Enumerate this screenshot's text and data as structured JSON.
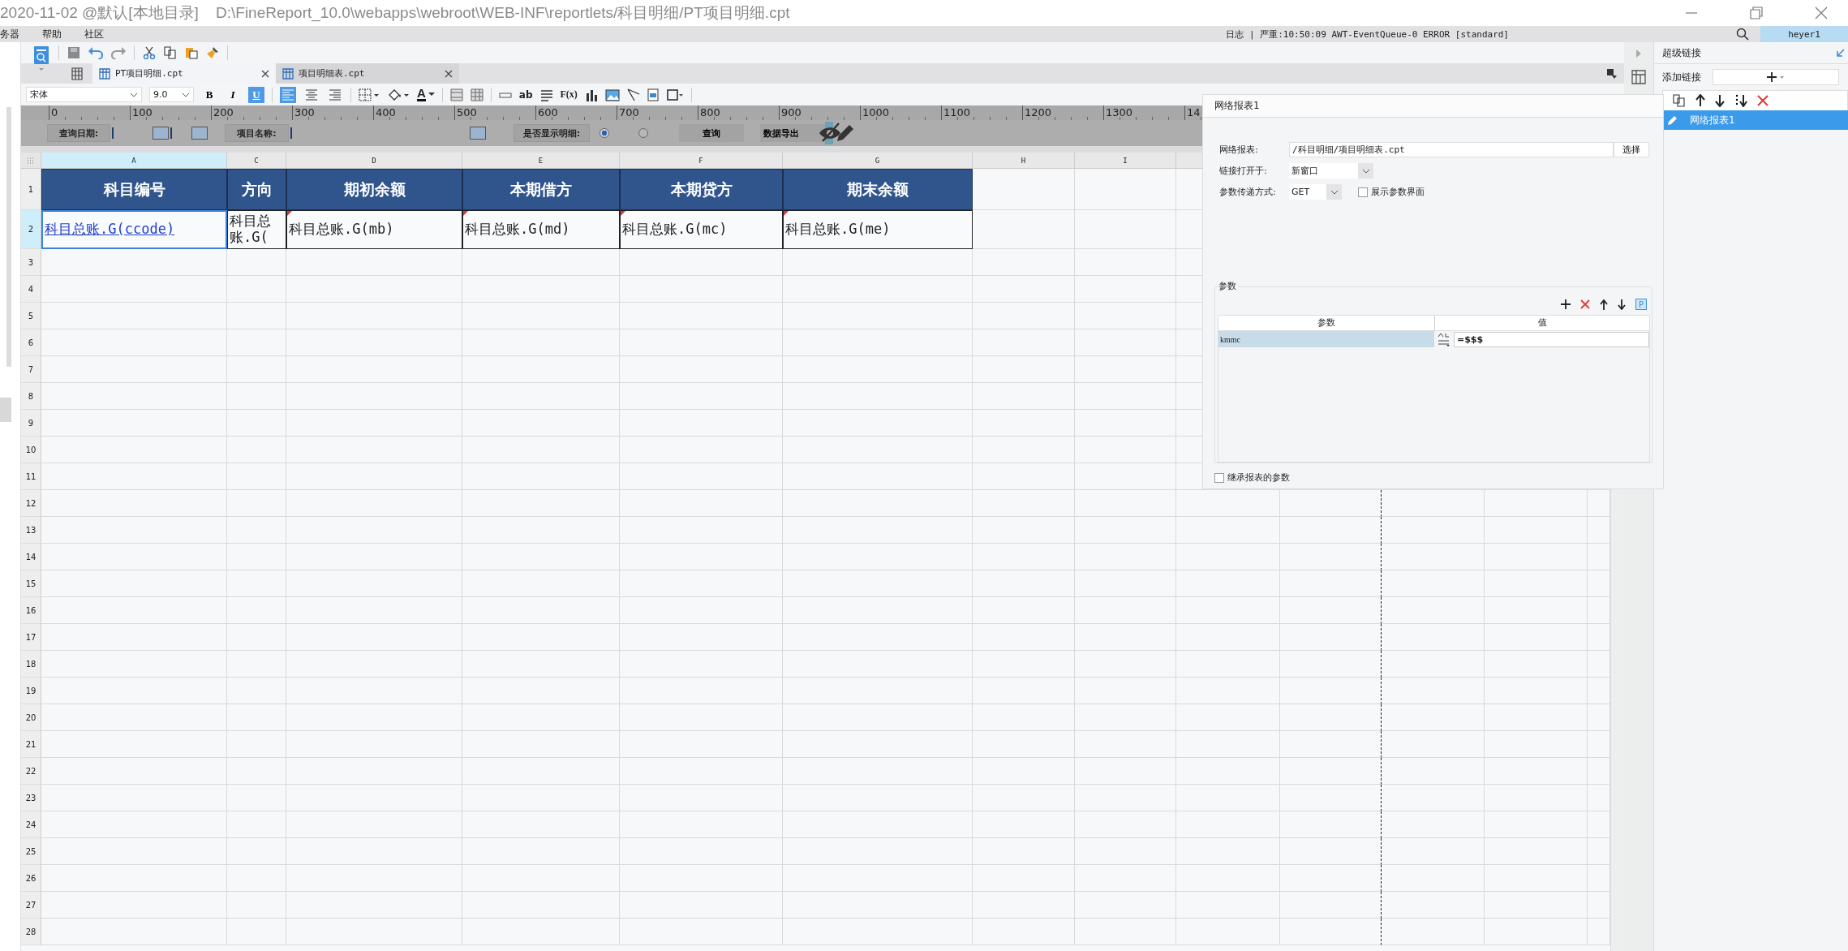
{
  "window": {
    "title": "2020-11-02 @默认[本地目录]    D:\\FineReport_10.0\\webapps\\webroot\\WEB-INF\\reportlets/科目明细/PT项目明细.cpt"
  },
  "menu": [
    {
      "label": "务器"
    },
    {
      "label": "帮助"
    },
    {
      "label": "社区"
    }
  ],
  "log": "日志 | 严重:10:50:09 AWT-EventQueue-0 ERROR [standard]",
  "user": "heyer1",
  "tabs": [
    {
      "label": "PT项目明细.cpt",
      "selected": true
    },
    {
      "label": "项目明细表.cpt",
      "selected": false
    }
  ],
  "format": {
    "font": "宋体",
    "size": "9.0",
    "style_buttons": [
      {
        "label": "B",
        "selected": false
      },
      {
        "label": "I",
        "selected": false
      },
      {
        "label": "U",
        "selected": true
      }
    ],
    "align": [
      {
        "selected": true
      },
      {
        "selected": false
      },
      {
        "selected": false
      }
    ],
    "font_color": "A",
    "text_buttons": [
      "ab",
      "F(x)"
    ]
  },
  "ruler": [
    "0",
    "100",
    "200",
    "300",
    "400",
    "500",
    "600",
    "700",
    "800",
    "900",
    "1000",
    "1100",
    "1200",
    "1300",
    "14"
  ],
  "parameter_form": {
    "date_label": "查询日期:",
    "name_label": "项目名称:",
    "detail_label": "是否显示明细:",
    "detail_options": [
      {
        "selected": true
      },
      {
        "selected": false
      }
    ],
    "buttons": [
      "查询",
      "数据导出"
    ]
  },
  "sheet": {
    "columns": [
      {
        "label": "A",
        "selected": true
      },
      {
        "label": "C",
        "selected": false
      },
      {
        "label": "D",
        "selected": false
      },
      {
        "label": "E",
        "selected": false
      },
      {
        "label": "F",
        "selected": false
      },
      {
        "label": "G",
        "selected": false
      },
      {
        "label": "H",
        "selected": false
      },
      {
        "label": "I",
        "selected": false
      }
    ],
    "rows": [
      {
        "number": "1",
        "selected": false,
        "cells": [
          {
            "kind": "header",
            "text": "科目编号"
          },
          {
            "kind": "header",
            "text": "方向"
          },
          {
            "kind": "header",
            "text": "期初余额"
          },
          {
            "kind": "header",
            "text": "本期借方"
          },
          {
            "kind": "header",
            "text": "本期贷方"
          },
          {
            "kind": "header",
            "text": "期末余额"
          }
        ]
      },
      {
        "number": "2",
        "selected": true,
        "cells": [
          {
            "kind": "link",
            "text": "科目总账.G(ccode)",
            "selected": true,
            "flag": false
          },
          {
            "kind": "text",
            "text": "科目总账.G(",
            "selected": false,
            "flag": false
          },
          {
            "kind": "text",
            "text": "科目总账.G(mb)",
            "selected": false,
            "flag": true
          },
          {
            "kind": "text",
            "text": "科目总账.G(md)",
            "selected": false,
            "flag": true
          },
          {
            "kind": "text",
            "text": "科目总账.G(mc)",
            "selected": false,
            "flag": true
          },
          {
            "kind": "text",
            "text": "科目总账.G(me)",
            "selected": false,
            "flag": true
          }
        ]
      },
      {
        "number": "3",
        "selected": false
      },
      {
        "number": "4",
        "selected": false
      },
      {
        "number": "5",
        "selected": false
      },
      {
        "number": "6",
        "selected": false
      },
      {
        "number": "7",
        "selected": false
      },
      {
        "number": "8",
        "selected": false
      },
      {
        "number": "9",
        "selected": false
      },
      {
        "number": "10",
        "selected": false
      },
      {
        "number": "11",
        "selected": false
      },
      {
        "number": "12",
        "selected": false
      },
      {
        "number": "13",
        "selected": false
      },
      {
        "number": "14",
        "selected": false
      },
      {
        "number": "15",
        "selected": false
      },
      {
        "number": "16",
        "selected": false
      },
      {
        "number": "17",
        "selected": false
      },
      {
        "number": "18",
        "selected": false
      },
      {
        "number": "19",
        "selected": false
      },
      {
        "number": "20",
        "selected": false
      },
      {
        "number": "21",
        "selected": false
      },
      {
        "number": "22",
        "selected": false
      },
      {
        "number": "23",
        "selected": false
      },
      {
        "number": "24",
        "selected": false
      },
      {
        "number": "25",
        "selected": false
      },
      {
        "number": "26",
        "selected": false
      },
      {
        "number": "27",
        "selected": false
      },
      {
        "number": "28",
        "selected": false
      }
    ]
  },
  "hyperlink_dialog": {
    "title": "网络报表1",
    "report_label": "网络报表:",
    "report_value": "/科目明细/项目明细表.cpt",
    "choose_button": "选择",
    "open_label": "链接打开于:",
    "open_value": "新窗口",
    "method_label": "参数传递方式:",
    "method_value": "GET",
    "show_params": {
      "label": "展示参数界面",
      "checked": false
    },
    "params_group": "参数",
    "p_button": "P",
    "param_columns": [
      "参数",
      "值"
    ],
    "params": [
      {
        "name": "kmmc",
        "value": "=$$$",
        "selected": true
      }
    ],
    "inherit": {
      "label": "继承报表的参数",
      "checked": false
    }
  },
  "hyperlink_panel": {
    "title": "超级链接",
    "add_label": "添加链接",
    "links": [
      {
        "label": "网络报表1",
        "selected": true
      }
    ]
  }
}
